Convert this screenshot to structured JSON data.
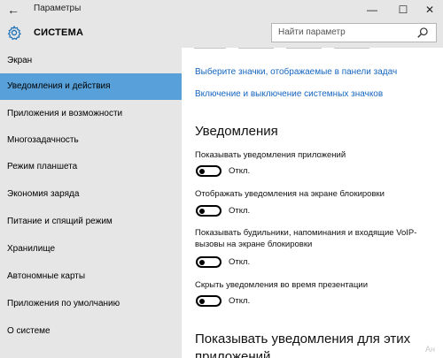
{
  "window": {
    "title": "Параметры",
    "back_glyph": "←",
    "min_glyph": "—",
    "max_glyph": "☐",
    "close_glyph": "✕"
  },
  "header": {
    "section_title": "СИСТЕМА",
    "search_placeholder": "Найти параметр",
    "icon": "gear-icon",
    "search_icon": "search-icon"
  },
  "sidebar": {
    "items": [
      {
        "label": "Экран",
        "active": false
      },
      {
        "label": "Уведомления и действия",
        "active": true
      },
      {
        "label": "Приложения и возможности",
        "active": false
      },
      {
        "label": "Многозадачность",
        "active": false
      },
      {
        "label": "Режим планшета",
        "active": false
      },
      {
        "label": "Экономия заряда",
        "active": false
      },
      {
        "label": "Питание и спящий режим",
        "active": false
      },
      {
        "label": "Хранилище",
        "active": false
      },
      {
        "label": "Автономные карты",
        "active": false
      },
      {
        "label": "Приложения по умолчанию",
        "active": false
      },
      {
        "label": "О системе",
        "active": false
      }
    ],
    "active_color": "#57a0d9"
  },
  "main": {
    "links": [
      "Выберите значки, отображаемые в панели задач",
      "Включение и выключение системных значков"
    ],
    "heading": "Уведомления",
    "options": [
      {
        "label": "Показывать уведомления приложений",
        "state": "Откл."
      },
      {
        "label": "Отображать уведомления на экране блокировки",
        "state": "Откл."
      },
      {
        "label": "Показывать будильники, напоминания и входящие VoIP-вызовы на экране блокировки",
        "state": "Откл."
      },
      {
        "label": "Скрыть уведомления во время презентации",
        "state": "Откл."
      }
    ],
    "heading2": "Показывать уведомления для этих приложений",
    "link_color": "#1565c0"
  },
  "watermark": "Ан"
}
